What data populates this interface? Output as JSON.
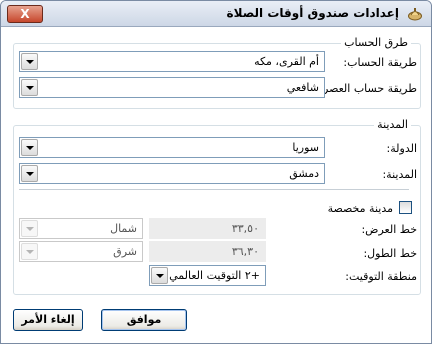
{
  "window": {
    "title": "إعدادات صندوق أوقات الصلاة",
    "close_label": "X"
  },
  "calculation": {
    "legend": "طرق الحساب",
    "method_label": "طريقة الحساب:",
    "method_value": "أم القرى، مكه",
    "asr_label": "طريقة حساب العصر:",
    "asr_value": "شافعي"
  },
  "city": {
    "legend": "المدينة",
    "country_label": "الدولة:",
    "country_value": "سوريا",
    "city_label": "المدينة:",
    "city_value": "دمشق",
    "custom_label": "مدينة مخصصة",
    "latitude_label": "خط العرض:",
    "latitude_value": "٣٣,٥٠",
    "latitude_dir": "شمال",
    "longitude_label": "خط الطول:",
    "longitude_value": "٣٦,٣٠",
    "longitude_dir": "شرق",
    "timezone_label": "منطقة التوقيت:",
    "timezone_value": "+٢ التوقيت العالمي"
  },
  "buttons": {
    "ok": "موافق",
    "cancel": "إلغاء الأمر"
  },
  "colors": {
    "accent": "#003c74",
    "close_button": "#c6472d"
  }
}
